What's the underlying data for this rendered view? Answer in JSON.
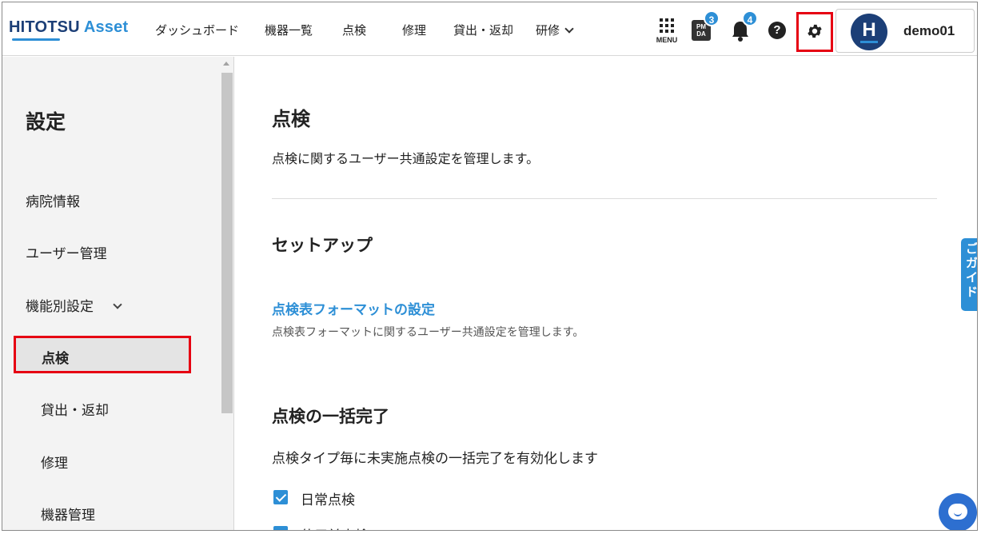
{
  "header": {
    "logo_main": "HITOTSU",
    "logo_accent": "Asset",
    "nav": [
      "ダッシュボード",
      "機器一覧",
      "点検",
      "修理",
      "貸出・返却"
    ],
    "nav_dropdown": "研修",
    "menu_label": "MENU",
    "pmda_label": "PM DA",
    "pmda_badge": "3",
    "bell_badge": "4",
    "help_label": "?",
    "avatar_letter": "H",
    "user_name": "demo01"
  },
  "sidebar": {
    "title": "設定",
    "items": [
      "病院情報",
      "ユーザー管理",
      "機能別設定"
    ],
    "sub_items": [
      "点検",
      "貸出・返却",
      "修理",
      "機器管理"
    ],
    "active_index": 0
  },
  "main": {
    "title": "点検",
    "description": "点検に関するユーザー共通設定を管理します。",
    "setup_heading": "セットアップ",
    "format_link": "点検表フォーマットの設定",
    "format_desc": "点検表フォーマットに関するユーザー共通設定を管理します。",
    "bulk_heading": "点検の一括完了",
    "bulk_desc": "点検タイプ毎に未実施点検の一括完了を有効化します",
    "checkboxes": [
      {
        "label": "日常点検",
        "checked": true
      },
      {
        "label": "使用前点検",
        "checked": true
      }
    ]
  },
  "guide_tab": "ご ガ イ ド",
  "colors": {
    "accent": "#2d8fd6",
    "brand_dark": "#1c3f77",
    "highlight": "#e60012"
  }
}
